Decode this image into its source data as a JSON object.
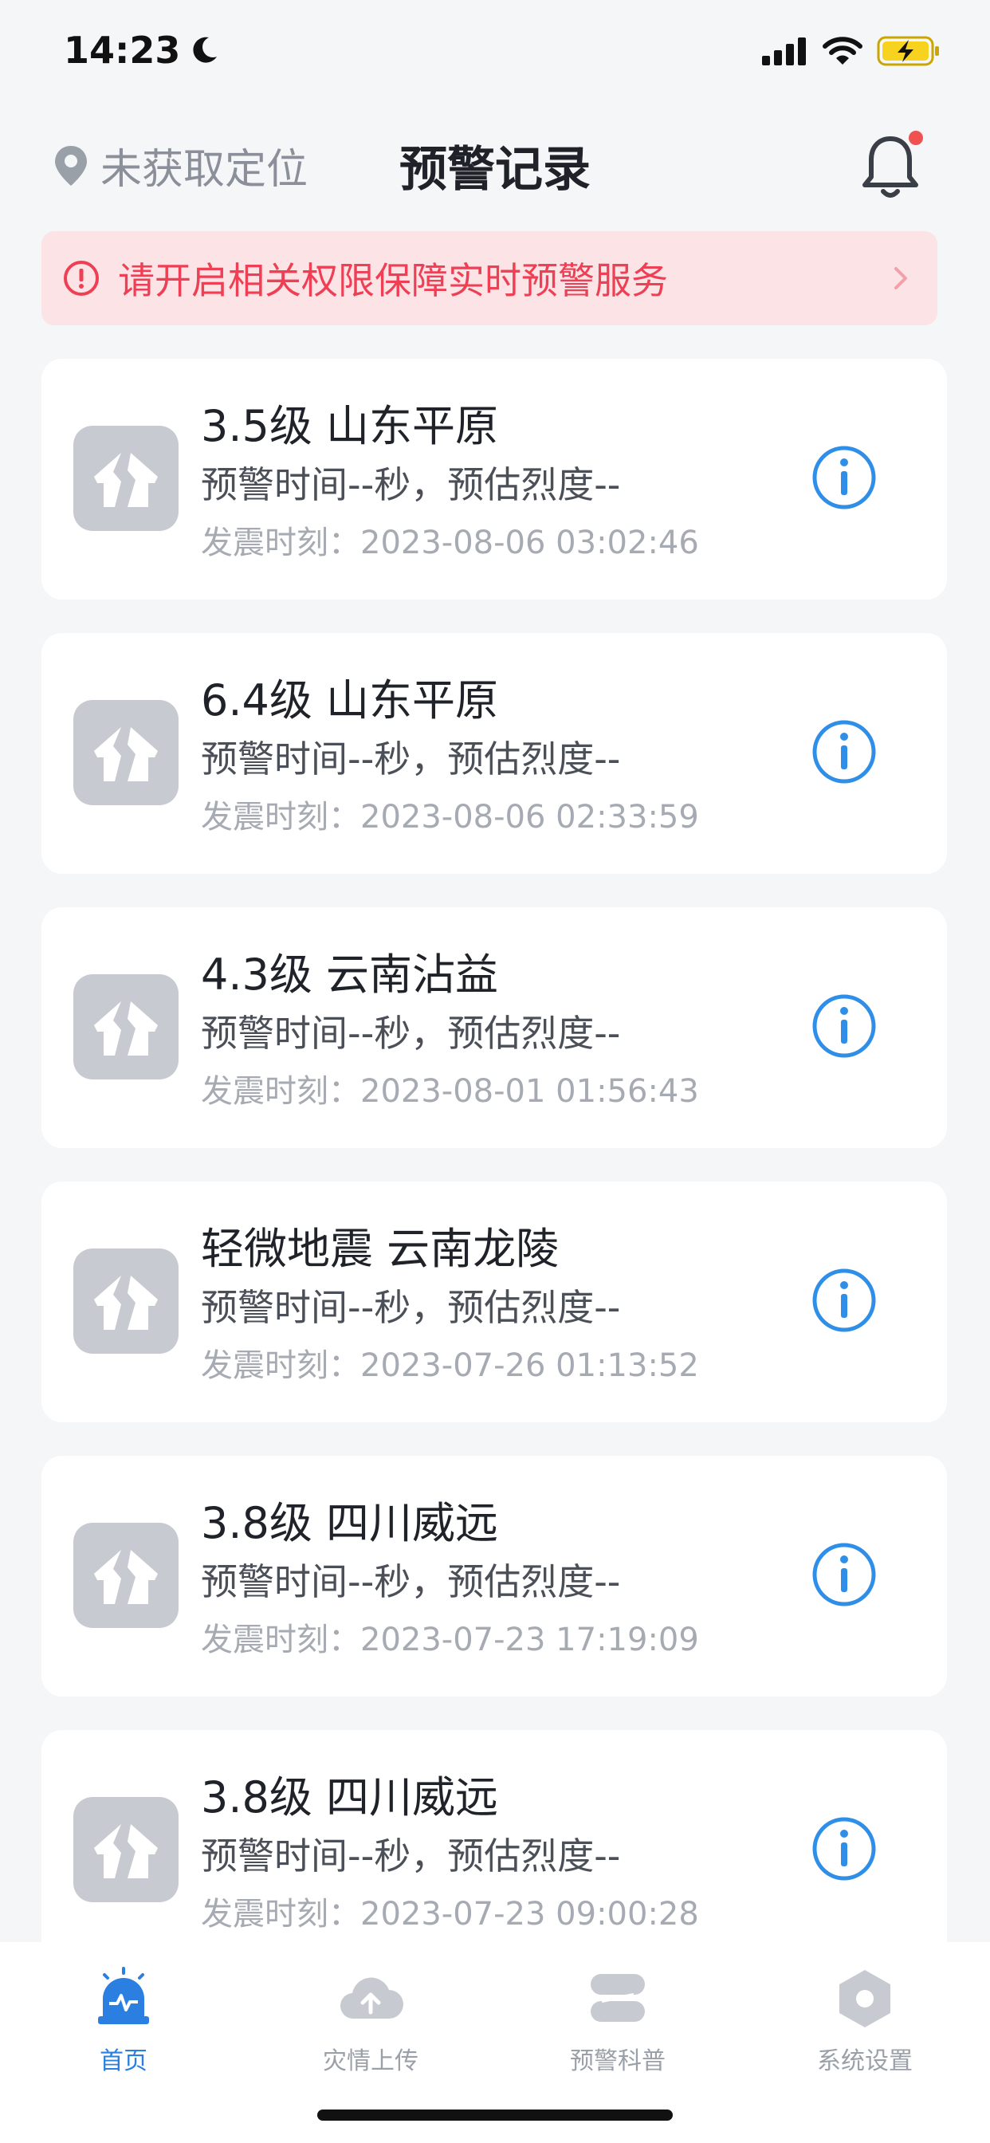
{
  "status_bar": {
    "time": "14:23"
  },
  "header": {
    "location_text": "未获取定位",
    "title": "预警记录"
  },
  "banner": {
    "text": "请开启相关权限保障实时预警服务"
  },
  "records": [
    {
      "title": "3.5级 山东平原",
      "warning": "预警时间--秒，预估烈度--",
      "time": "发震时刻：2023-08-06 03:02:46"
    },
    {
      "title": "6.4级 山东平原",
      "warning": "预警时间--秒，预估烈度--",
      "time": "发震时刻：2023-08-06 02:33:59"
    },
    {
      "title": "4.3级 云南沾益",
      "warning": "预警时间--秒，预估烈度--",
      "time": "发震时刻：2023-08-01 01:56:43"
    },
    {
      "title": "轻微地震 云南龙陵",
      "warning": "预警时间--秒，预估烈度--",
      "time": "发震时刻：2023-07-26 01:13:52"
    },
    {
      "title": "3.8级 四川威远",
      "warning": "预警时间--秒，预估烈度--",
      "time": "发震时刻：2023-07-23 17:19:09"
    },
    {
      "title": "3.8级 四川威远",
      "warning": "预警时间--秒，预估烈度--",
      "time": "发震时刻：2023-07-23 09:00:28"
    }
  ],
  "tabs": [
    {
      "label": "首页",
      "icon": "alarm-light-icon",
      "active": true
    },
    {
      "label": "灾情上传",
      "icon": "cloud-upload-icon",
      "active": false
    },
    {
      "label": "预警科普",
      "icon": "layers-icon",
      "active": false
    },
    {
      "label": "系统设置",
      "icon": "settings-hexagon-icon",
      "active": false
    }
  ],
  "colors": {
    "accent": "#2a7fe0",
    "banner_bg": "#fbe3e6",
    "banner_text": "#ee3f54",
    "info_icon": "#2f8ee8",
    "quake_icon_bg": "#c7cbd1"
  }
}
